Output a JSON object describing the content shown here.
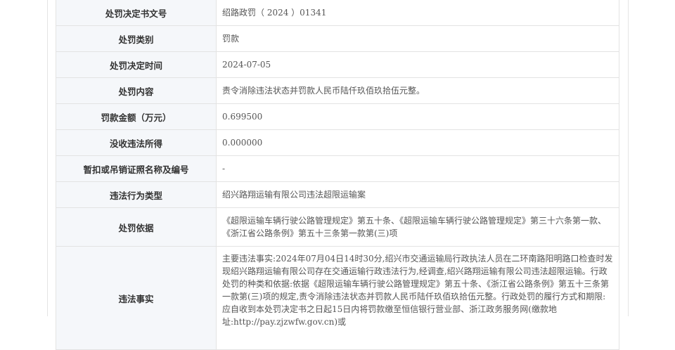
{
  "table": {
    "rows": [
      {
        "label": "处罚决定书文号",
        "value": "绍路政罚（ 2024 ）01341"
      },
      {
        "label": "处罚类别",
        "value": "罚款"
      },
      {
        "label": "处罚决定时间",
        "value": "2024-07-05"
      },
      {
        "label": "处罚内容",
        "value": "责令消除违法状态并罚款人民币陆仟玖佰玖拾伍元整。"
      },
      {
        "label": "罚款金额（万元）",
        "value": "0.699500"
      },
      {
        "label": "没收违法所得",
        "value": "0.000000"
      },
      {
        "label": "暂扣或吊销证照名称及编号",
        "value": "-"
      },
      {
        "label": "违法行为类型",
        "value": "绍兴路翔运输有限公司违法超限运输案"
      },
      {
        "label": "处罚依据",
        "value": "《超限运输车辆行驶公路管理规定》第五十条、《超限运输车辆行驶公路管理规定》第三十六条第一款、《浙江省公路条例》第五十三条第一款第(三)项"
      },
      {
        "label": "违法事实",
        "value": "主要违法事实:2024年07月04日14时30分,绍兴市交通运输局行政执法人员在二环南路阳明路口检查时发现绍兴路翔运输有限公司存在交通运输行政违法行为,经调查,绍兴路翔运输有限公司违法超限运输。行政处罚的种类和依据:依据《超限运输车辆行驶公路管理规定》第五十条、《浙江省公路条例》第五十三条第一款第(三)项的规定,责令消除违法状态并罚款人民币陆仟玖佰玖拾伍元整。行政处罚的履行方式和期限:应自收到本处罚决定书之日起15日内将罚款缴至恒信银行营业部、浙江政务服务网(缴款地址:http://pay.zjzwfw.gov.cn)或"
      }
    ]
  }
}
